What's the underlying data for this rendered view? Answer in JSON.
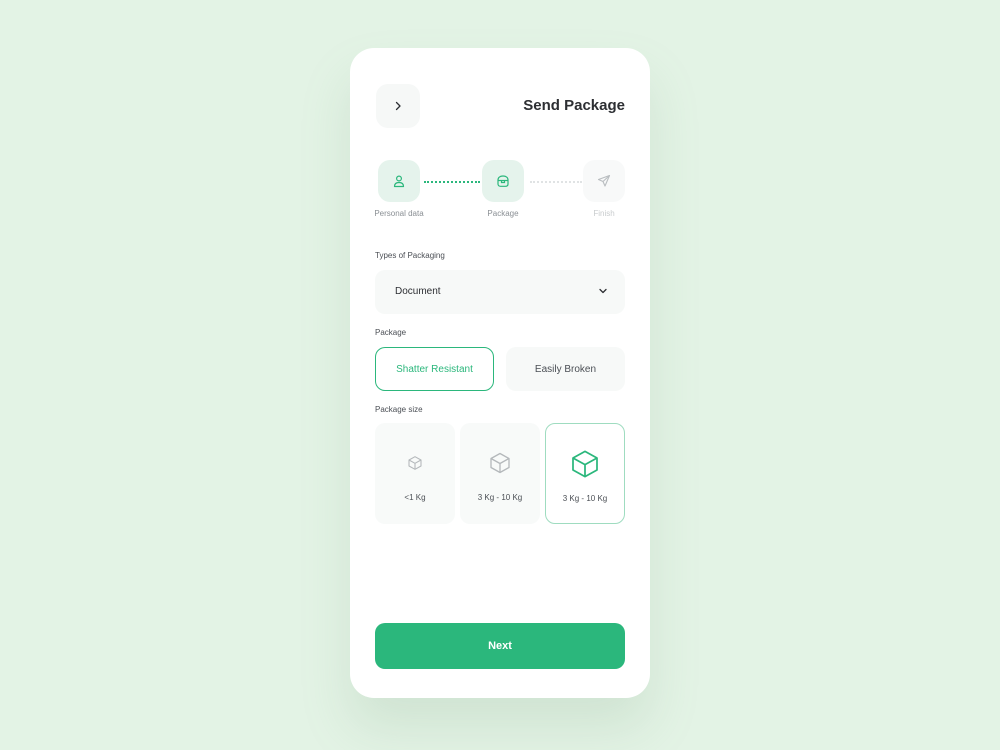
{
  "header": {
    "title": "Send Package",
    "back_icon": "chevron-right-icon"
  },
  "stepper": {
    "steps": [
      {
        "label": "Personal data",
        "icon": "user-icon",
        "state": "done"
      },
      {
        "label": "Package",
        "icon": "package-icon",
        "state": "active"
      },
      {
        "label": "Finish",
        "icon": "send-icon",
        "state": "pending"
      }
    ]
  },
  "packaging": {
    "label": "Types of Packaging",
    "selected": "Document"
  },
  "package": {
    "label": "Package",
    "options": [
      "Shatter Resistant",
      "Easily Broken"
    ],
    "selected_index": 0
  },
  "package_size": {
    "label": "Package size",
    "options": [
      {
        "label": "<1 Kg",
        "icon": "box-icon"
      },
      {
        "label": "3 Kg - 10 Kg",
        "icon": "box-icon"
      },
      {
        "label": "3 Kg - 10 Kg",
        "icon": "box-icon"
      }
    ],
    "selected_index": 2
  },
  "next_label": "Next",
  "colors": {
    "accent": "#2bb77c",
    "background": "#e3f3e5",
    "step_bg": "#e5f3ec"
  }
}
